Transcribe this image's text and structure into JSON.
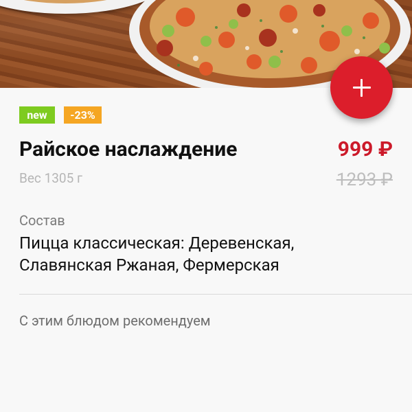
{
  "product": {
    "badge_new": "new",
    "badge_discount": "-23%",
    "title": "Райское наслаждение",
    "price": "999 ₽",
    "old_price": "1293 ₽",
    "weight": "Вес 1305 г"
  },
  "composition": {
    "label": "Состав",
    "text": "Пицца классическая: Деревенская, Славянская Ржаная, Фермерская"
  },
  "recommend": {
    "label": "С этим блюдом рекомендуем"
  },
  "colors": {
    "accent": "#dc1e2b",
    "price": "#cc1a2a",
    "badge_new": "#7ecb20",
    "badge_discount": "#f5a623"
  },
  "icons": {
    "add": "plus-icon"
  }
}
